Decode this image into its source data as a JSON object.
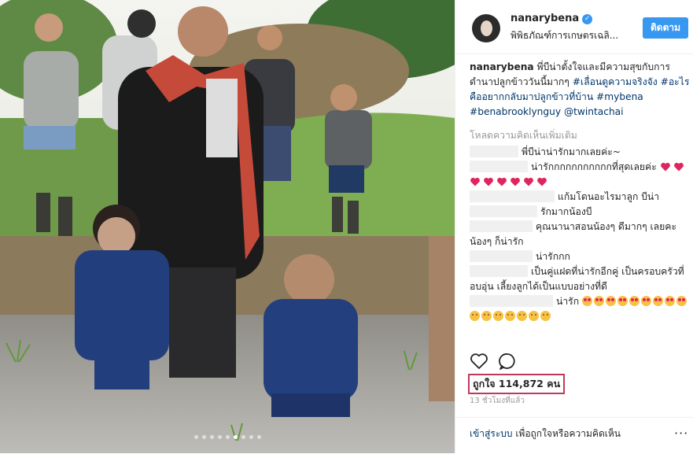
{
  "post": {
    "username": "nanarybena",
    "location": "พิพิธภัณฑ์การเกษตรเฉลิ...",
    "follow_label": "ติดตาม",
    "verified_mark": "✓",
    "caption_username": "nanarybena",
    "caption_text_1": " พี่บีน่าตั้งใจและมีความสุขกับการดำนาปลูกข้าววันนี้มากๆ ",
    "hashtag_1": "#เลื่อนดูความจริงจัง",
    "hashtag_2": "#อะไรคืออยากกลับมาปลูกข้าวที่บ้าน",
    "hashtag_3": "#mybena",
    "hashtag_4": "#benabrooklynguy",
    "mention_1": "@twintachai",
    "load_more": "โหลดความคิดเห็นเพิ่มเติม",
    "likes": "ถูกใจ 114,872 คน",
    "time": "13 ชั่วโมงที่แล้ว",
    "login_link": "เข้าสู่ระบบ",
    "login_text": " เพื่อถูกใจหรือความคิดเห็น",
    "more_label": "···",
    "carousel_active": 6,
    "carousel_total": 9
  },
  "comments": [
    {
      "text": "พี่บีน่าน่ารักมากเลยค่ะ~"
    },
    {
      "text": "น่ารักกกกกกกกกกกที่สุดเลยค่ะ"
    },
    {
      "text": "แก้มโดนอะไรมาลูก บีน่า"
    },
    {
      "text": "รักมากน้องบี"
    },
    {
      "text": "คุณนานาสอนน้องๆ ดีมากๆ เลยคะ น้องๆ ก็น่ารัก"
    },
    {
      "text": "น่ารักกก"
    },
    {
      "text": "เป็นคู่แฝดที่น่ารักอีกคู่ เป็นครอบครัวที่อบอุ่น เลี้ยงลูกได้เป็นแบบอย่างที่ดี"
    },
    {
      "text": "น่ารัก"
    }
  ],
  "icons": [
    "heart-icon",
    "comment-icon",
    "verified-badge-icon",
    "more-options-icon"
  ],
  "colors": {
    "accent": "#3897f0",
    "hashtag": "#003569",
    "highlight_box": "#c0395a",
    "heart": "#e0245e"
  }
}
